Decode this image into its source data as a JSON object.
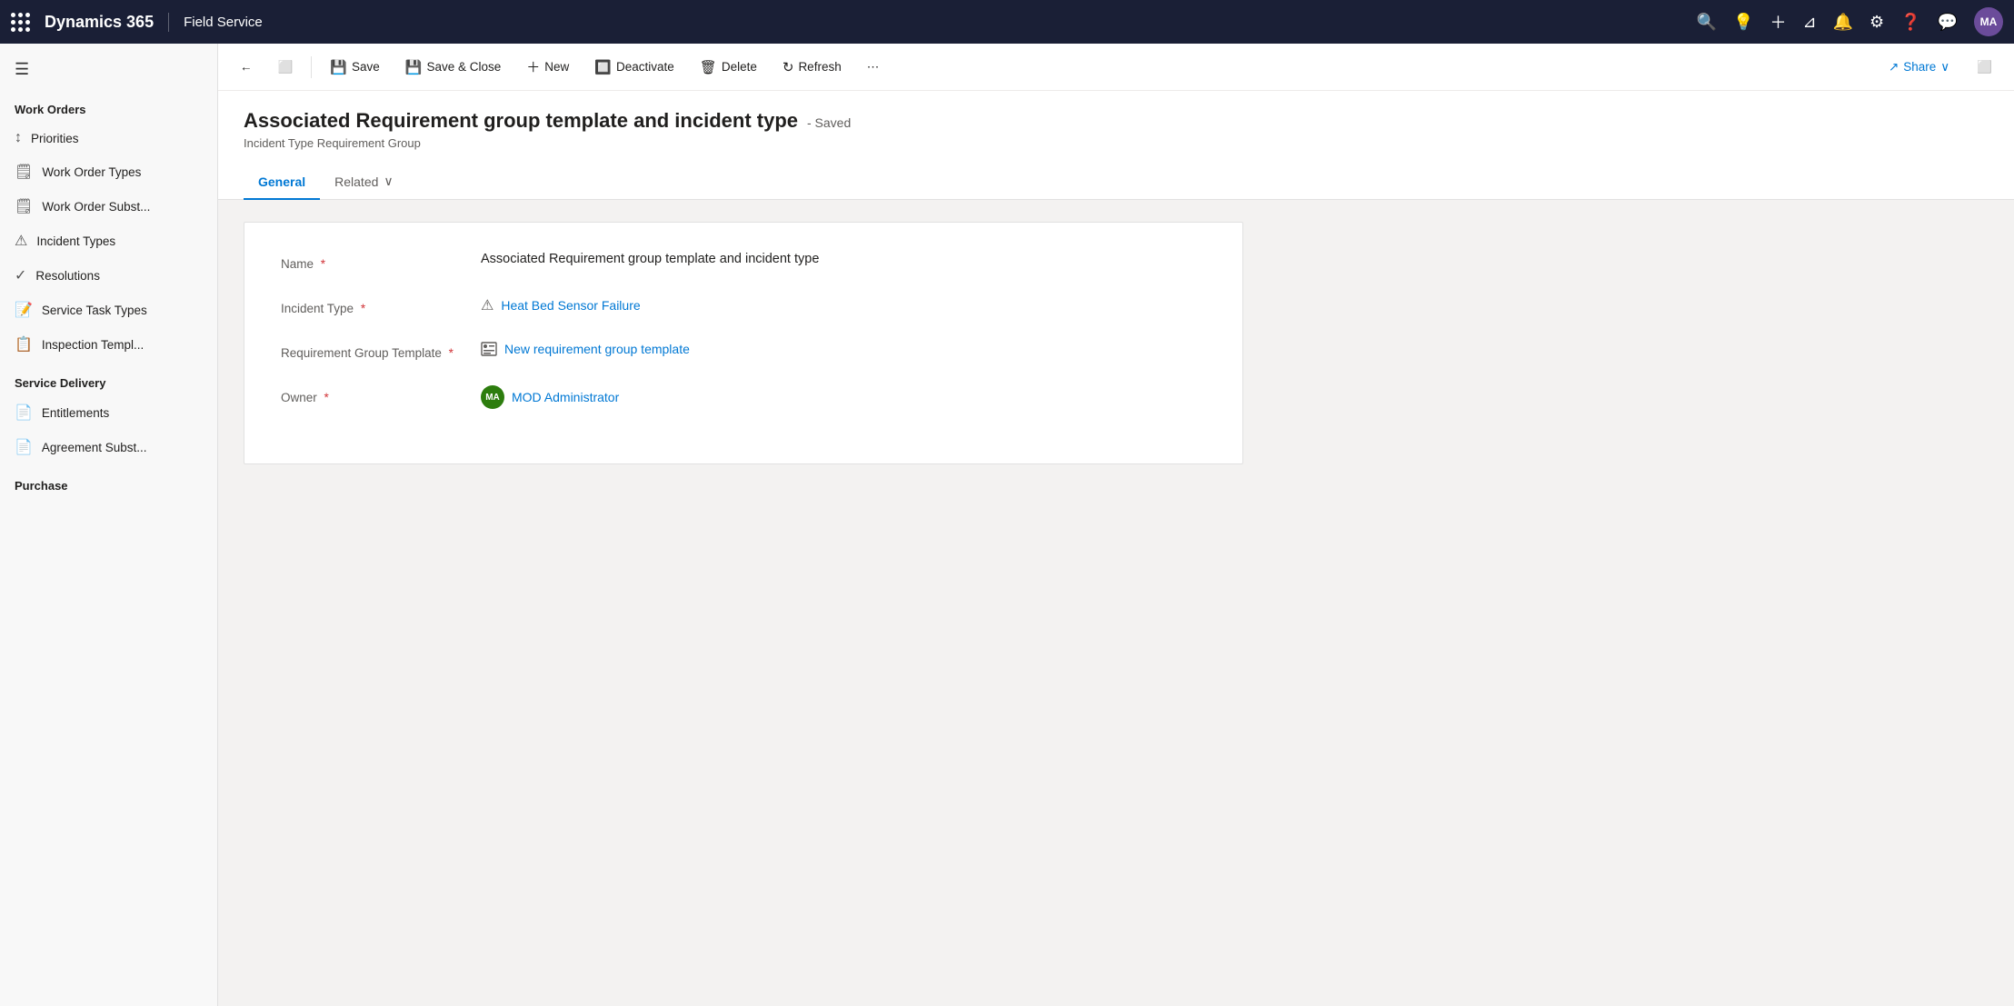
{
  "topnav": {
    "app_name": "Dynamics 365",
    "module_name": "Field Service",
    "user_initials": "MA"
  },
  "toolbar": {
    "save_label": "Save",
    "save_close_label": "Save & Close",
    "new_label": "New",
    "deactivate_label": "Deactivate",
    "delete_label": "Delete",
    "refresh_label": "Refresh",
    "share_label": "Share"
  },
  "page": {
    "title": "Associated Requirement group template and incident type",
    "saved_badge": "- Saved",
    "subtitle": "Incident Type Requirement Group"
  },
  "tabs": [
    {
      "id": "general",
      "label": "General",
      "active": true
    },
    {
      "id": "related",
      "label": "Related",
      "active": false,
      "has_dropdown": true
    }
  ],
  "form": {
    "fields": [
      {
        "id": "name",
        "label": "Name",
        "required": true,
        "value": "Associated Requirement group template and incident type",
        "type": "text"
      },
      {
        "id": "incident_type",
        "label": "Incident Type",
        "required": true,
        "value": "Heat Bed Sensor Failure",
        "type": "link",
        "icon": "warning"
      },
      {
        "id": "requirement_group_template",
        "label": "Requirement Group Template",
        "required": true,
        "value": "New requirement group template",
        "type": "link",
        "icon": "group"
      },
      {
        "id": "owner",
        "label": "Owner",
        "required": true,
        "value": "MOD Administrator",
        "type": "owner",
        "avatar_initials": "MA"
      }
    ]
  },
  "sidebar": {
    "work_orders_title": "Work Orders",
    "items_work_orders": [
      {
        "id": "priorities",
        "label": "Priorities",
        "icon": "↕"
      },
      {
        "id": "work-order-types",
        "label": "Work Order Types",
        "icon": "📋"
      },
      {
        "id": "work-order-subst",
        "label": "Work Order Subst...",
        "icon": "📋"
      },
      {
        "id": "incident-types",
        "label": "Incident Types",
        "icon": "⚠"
      },
      {
        "id": "resolutions",
        "label": "Resolutions",
        "icon": "✓"
      },
      {
        "id": "service-task-types",
        "label": "Service Task Types",
        "icon": "📝"
      },
      {
        "id": "inspection-templ",
        "label": "Inspection Templ...",
        "icon": "📋"
      }
    ],
    "service_delivery_title": "Service Delivery",
    "items_service_delivery": [
      {
        "id": "entitlements",
        "label": "Entitlements",
        "icon": "📄"
      },
      {
        "id": "agreement-subst",
        "label": "Agreement Subst...",
        "icon": "📄"
      }
    ],
    "purchase_title": "Purchase"
  }
}
